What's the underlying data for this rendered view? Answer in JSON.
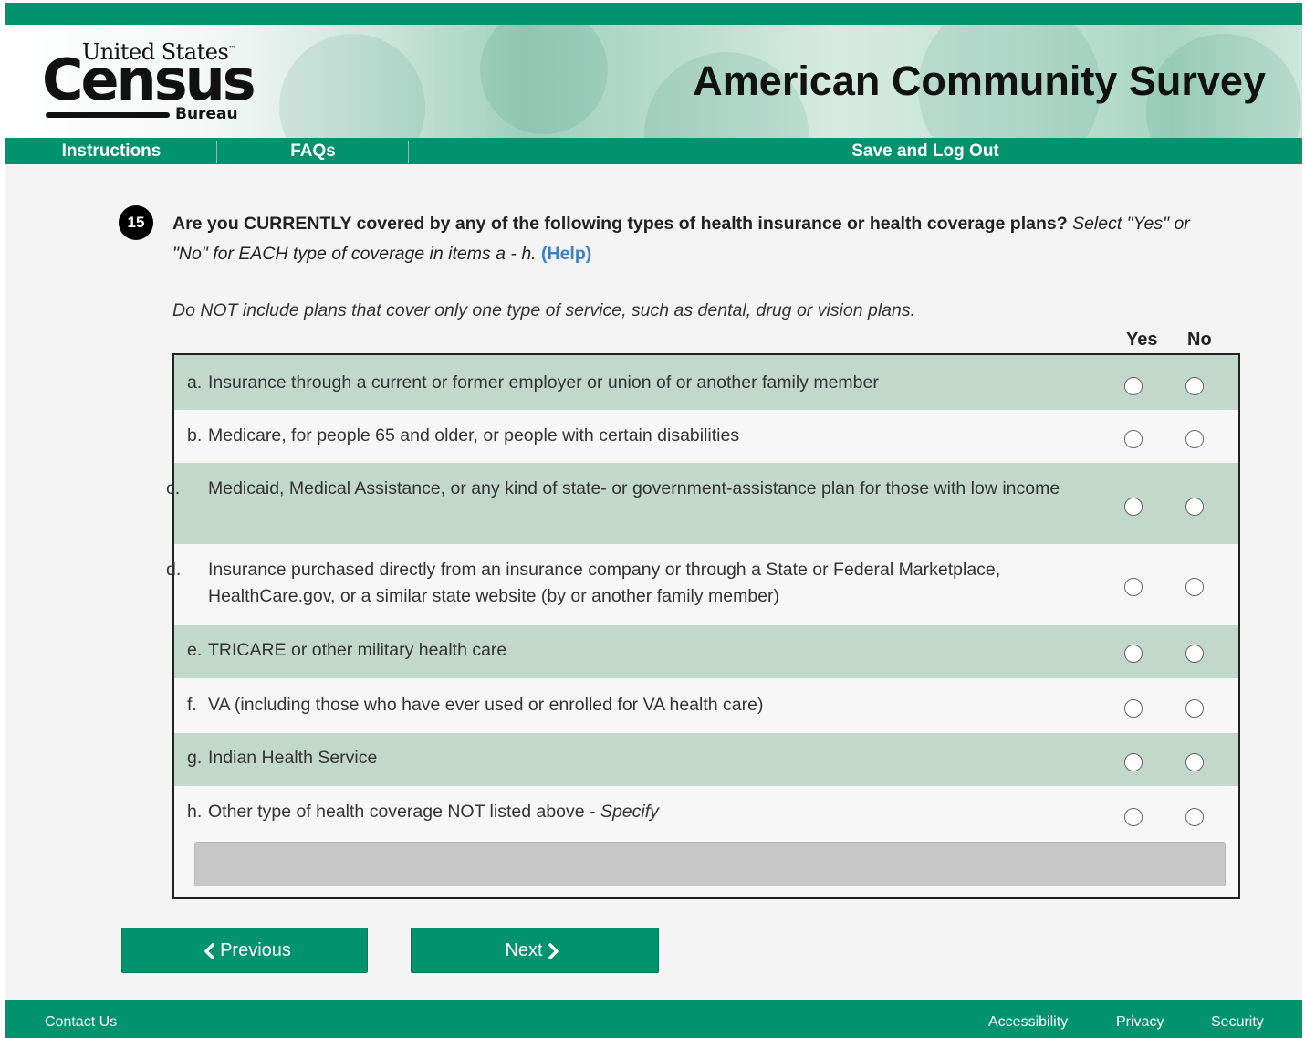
{
  "header": {
    "logo": {
      "line1": "United States",
      "tm": "™",
      "line2": "Census",
      "line3": "Bureau"
    },
    "title": "American Community Survey"
  },
  "nav": {
    "instructions": "Instructions",
    "faqs": "FAQs",
    "save_logout": "Save and Log Out"
  },
  "question": {
    "number": "15",
    "text_bold": "Are you CURRENTLY covered by any of the following types of health insurance or health coverage plans?",
    "text_italic": "Select \"Yes\" or \"No\" for EACH type of coverage in items a - h.",
    "help": "(Help)",
    "note": "Do NOT include plans that cover only one type of service, such as dental, drug or vision plans."
  },
  "columns": {
    "yes": "Yes",
    "no": "No"
  },
  "items": [
    {
      "letter": "a.",
      "text": "Insurance through a current or former employer or union of or another family member"
    },
    {
      "letter": "b.",
      "text": "Medicare, for people 65 and older, or people with certain disabilities"
    },
    {
      "letter": "c.",
      "text": "Medicaid, Medical Assistance, or any kind of state- or government-assistance plan for those with low income"
    },
    {
      "letter": "d.",
      "text": "Insurance purchased directly from an insurance company or through a State or Federal Marketplace, HealthCare.gov, or a similar state website (by or another family member)"
    },
    {
      "letter": "e.",
      "text": "TRICARE or other military health care"
    },
    {
      "letter": "f.",
      "text": "VA (including those who have ever used or enrolled for VA health care)"
    },
    {
      "letter": "g.",
      "text": "Indian Health Service"
    },
    {
      "letter": "h.",
      "text": "Other type of health coverage NOT listed above - ",
      "italic_suffix": "Specify"
    }
  ],
  "specify_input": {
    "value": ""
  },
  "buttons": {
    "previous": "Previous",
    "next": "Next"
  },
  "footer": {
    "contact": "Contact Us",
    "accessibility": "Accessibility",
    "privacy": "Privacy",
    "security": "Security"
  },
  "colors": {
    "brand_green": "#00936e",
    "row_shade": "#c1d8cb",
    "link_blue": "#3b7fc4"
  }
}
